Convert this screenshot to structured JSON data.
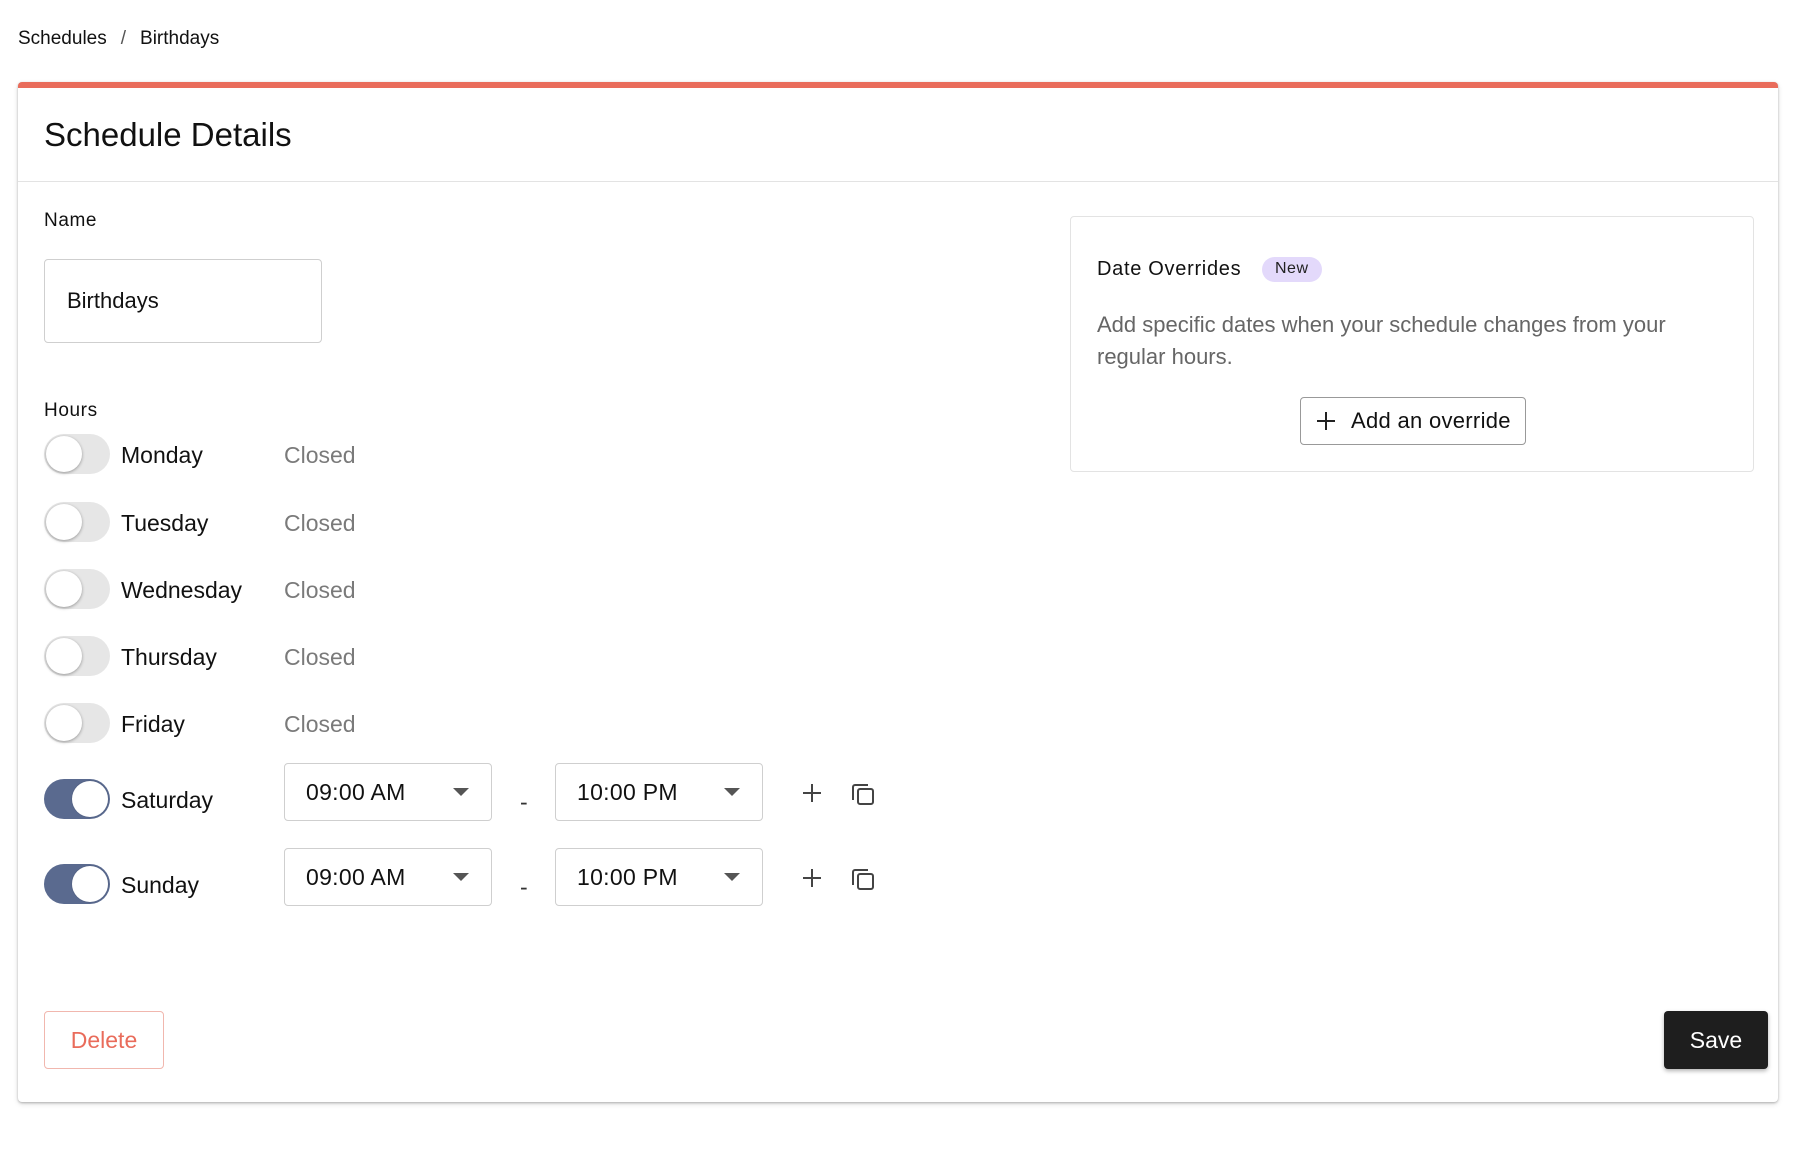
{
  "breadcrumb": {
    "parent": "Schedules",
    "separator": "/",
    "current": "Birthdays"
  },
  "card": {
    "title": "Schedule Details",
    "accent_color": "#e96c5b"
  },
  "name_field": {
    "label": "Name",
    "value": "Birthdays"
  },
  "hours": {
    "label": "Hours",
    "closed_text": "Closed",
    "range_separator": "-",
    "days": [
      {
        "name": "Monday",
        "enabled": false,
        "status": "Closed"
      },
      {
        "name": "Tuesday",
        "enabled": false,
        "status": "Closed"
      },
      {
        "name": "Wednesday",
        "enabled": false,
        "status": "Closed"
      },
      {
        "name": "Thursday",
        "enabled": false,
        "status": "Closed"
      },
      {
        "name": "Friday",
        "enabled": false,
        "status": "Closed"
      },
      {
        "name": "Saturday",
        "enabled": true,
        "start": "09:00 AM",
        "end": "10:00 PM"
      },
      {
        "name": "Sunday",
        "enabled": true,
        "start": "09:00 AM",
        "end": "10:00 PM"
      }
    ]
  },
  "date_overrides": {
    "title": "Date Overrides",
    "badge": "New",
    "description": "Add specific dates when your schedule changes from your regular hours.",
    "add_button_label": "Add an override"
  },
  "actions": {
    "delete_label": "Delete",
    "save_label": "Save"
  },
  "icons": {
    "add": "plus-icon",
    "copy": "copy-icon",
    "dropdown": "chevron-down-icon"
  },
  "colors": {
    "toggle_on": "#5a6a8f",
    "badge_bg": "#e3d9fb",
    "delete_text": "#e96c5b",
    "save_bg": "#1e1e1e"
  }
}
